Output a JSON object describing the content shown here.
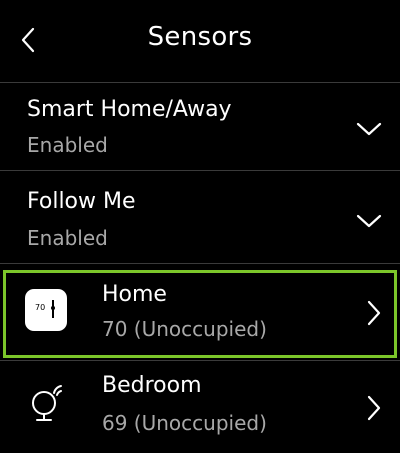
{
  "header": {
    "title": "Sensors",
    "back_icon": "chevron-left-icon"
  },
  "settings": [
    {
      "label": "Smart Home/Away",
      "status": "Enabled",
      "icon": "chevron-down-icon"
    },
    {
      "label": "Follow Me",
      "status": "Enabled",
      "icon": "chevron-down-icon"
    }
  ],
  "sensors": [
    {
      "name": "Home",
      "reading": "70 (Unoccupied)",
      "icon": "thermostat-icon",
      "icon_text": "70",
      "selected": true,
      "chevron": "chevron-right-icon"
    },
    {
      "name": "Bedroom",
      "reading": "69 (Unoccupied)",
      "icon": "remote-sensor-icon",
      "selected": false,
      "chevron": "chevron-right-icon"
    }
  ],
  "colors": {
    "background": "#000000",
    "selection": "#7cc62a",
    "secondary_text": "#a8a8a8",
    "divider": "#3a3a3a"
  }
}
